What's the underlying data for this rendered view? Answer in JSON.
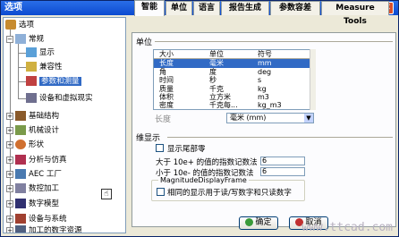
{
  "window": {
    "title": "选项"
  },
  "tree": {
    "root_label": "选项",
    "items": [
      {
        "label": "常规"
      },
      {
        "label": "显示"
      },
      {
        "label": "兼容性"
      },
      {
        "label": "参数和测量"
      },
      {
        "label": "设备和虚拟现实"
      },
      {
        "label": "基础结构"
      },
      {
        "label": "机械设计"
      },
      {
        "label": "形状"
      },
      {
        "label": "分析与仿真"
      },
      {
        "label": "AEC 工厂"
      },
      {
        "label": "数控加工"
      },
      {
        "label": "数字模型"
      },
      {
        "label": "设备与系统"
      },
      {
        "label": "加工的数字资源"
      }
    ]
  },
  "tabs": [
    {
      "label": "智能"
    },
    {
      "label": "单位"
    },
    {
      "label": "语言"
    },
    {
      "label": "报告生成"
    },
    {
      "label": "参数容差"
    },
    {
      "label": "Measure Tools"
    }
  ],
  "units": {
    "group_label": "单位",
    "columns": [
      "大小",
      "单位",
      "符号"
    ],
    "rows": [
      {
        "size": "长度",
        "unit": "毫米",
        "symbol": "mm"
      },
      {
        "size": "角",
        "unit": "度",
        "symbol": "deg"
      },
      {
        "size": "时间",
        "unit": "秒",
        "symbol": "s"
      },
      {
        "size": "质量",
        "unit": "千克",
        "symbol": "kg"
      },
      {
        "size": "体积",
        "unit": "立方米",
        "symbol": "m3"
      },
      {
        "size": "密度",
        "unit": "千克每...",
        "symbol": "kg_m3"
      }
    ],
    "combo_label": "长度",
    "combo_value": "毫米 (mm)"
  },
  "display": {
    "group_label": "维显示",
    "show_trailing_zeros": "显示尾部零",
    "greater_than_label": "大于 10e+ 的值的指数记数法",
    "greater_than_value": "6",
    "less_than_label": "小于 10e- 的值的指数记数法",
    "less_than_value": "6",
    "magnitude_legend": "MagnitudeDisplayFrame",
    "magnitude_check_label": "相同的显示用于读/写数字和只读数字"
  },
  "buttons": {
    "ok": "确定",
    "cancel": "取消"
  },
  "watermark": "www.ttcad.com",
  "colors": {
    "title_bg": "#0b4ad0",
    "selection": "#316ac5",
    "dialog_bg": "#ece9d8"
  }
}
